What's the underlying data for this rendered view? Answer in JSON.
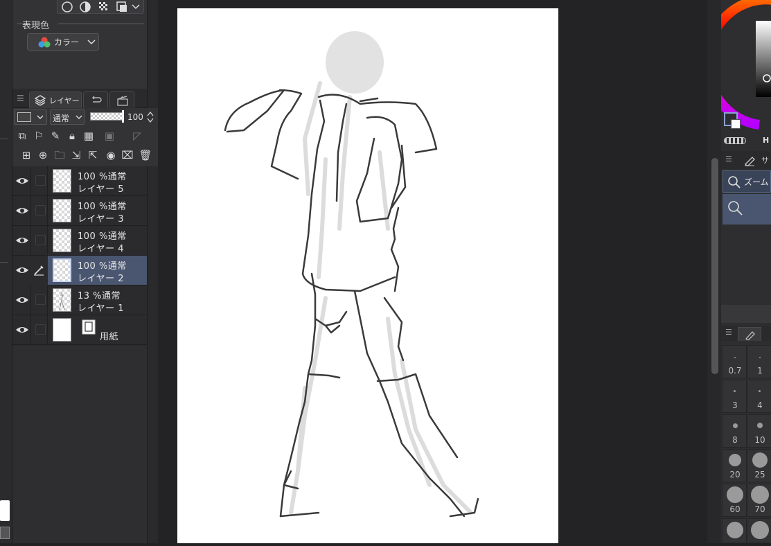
{
  "tool_property": {
    "expression_color_label": "表現色",
    "expression_color_value": "カラー"
  },
  "layer_panel": {
    "tab_label": "レイヤー",
    "blend_mode": "通常",
    "opacity": "100",
    "layers": [
      {
        "top": "100 %通常",
        "name": "レイヤー 5",
        "selected": false,
        "editing": false
      },
      {
        "top": "100 %通常",
        "name": "レイヤー 3",
        "selected": false,
        "editing": false
      },
      {
        "top": "100 %通常",
        "name": "レイヤー 4",
        "selected": false,
        "editing": false
      },
      {
        "top": "100 %通常",
        "name": "レイヤー 2",
        "selected": true,
        "editing": true
      },
      {
        "top": "13 %通常",
        "name": "レイヤー 1",
        "selected": false,
        "editing": false
      },
      {
        "top": "",
        "name": "用紙",
        "selected": false,
        "editing": false
      }
    ]
  },
  "navigator": {
    "tab_label": "サ",
    "zoom_label": "ズーム"
  },
  "color": {
    "h_label": "H",
    "main_color": "#ffffff",
    "sub_color": "#000000"
  },
  "brush_sizes": [
    "0.7",
    "1",
    "3",
    "4",
    "8",
    "10",
    "20",
    "25",
    "60",
    "70"
  ]
}
